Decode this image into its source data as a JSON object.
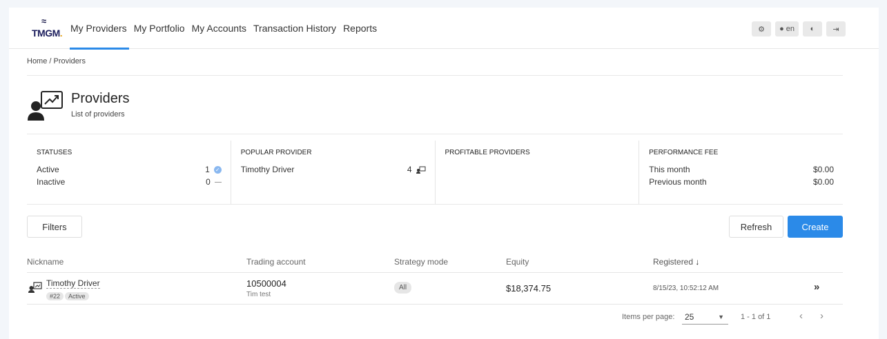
{
  "logo": {
    "text": "TMGM",
    "dot": "."
  },
  "nav": {
    "items": [
      {
        "label": "My Providers",
        "active": true
      },
      {
        "label": "My Portfolio"
      },
      {
        "label": "My Accounts"
      },
      {
        "label": "Transaction History"
      },
      {
        "label": "Reports"
      }
    ],
    "language": "en"
  },
  "breadcrumb": "Home / Providers",
  "page": {
    "title": "Providers",
    "subtitle": "List of providers"
  },
  "stats": {
    "statuses": {
      "heading": "STATUSES",
      "active_label": "Active",
      "active_count": "1",
      "inactive_label": "Inactive",
      "inactive_count": "0"
    },
    "popular": {
      "heading": "POPULAR PROVIDER",
      "name": "Timothy Driver",
      "count": "4"
    },
    "profitable": {
      "heading": "PROFITABLE PROVIDERS"
    },
    "fee": {
      "heading": "PERFORMANCE FEE",
      "this_month_label": "This month",
      "this_month": "$0.00",
      "prev_month_label": "Previous month",
      "prev_month": "$0.00"
    }
  },
  "toolbar": {
    "filters": "Filters",
    "refresh": "Refresh",
    "create": "Create"
  },
  "table": {
    "headers": {
      "nickname": "Nickname",
      "account": "Trading account",
      "mode": "Strategy mode",
      "equity": "Equity",
      "registered": "Registered"
    },
    "rows": [
      {
        "nickname": "Timothy Driver",
        "id": "#22",
        "status": "Active",
        "account": "10500004",
        "account_name": "Tim test",
        "mode": "All",
        "equity": "$18,374.75",
        "registered": "8/15/23, 10:52:12 AM"
      }
    ]
  },
  "pager": {
    "label": "Items per page:",
    "per_page": "25",
    "range": "1 - 1 of 1"
  },
  "colors": {
    "accent": "#2b8ae8"
  }
}
